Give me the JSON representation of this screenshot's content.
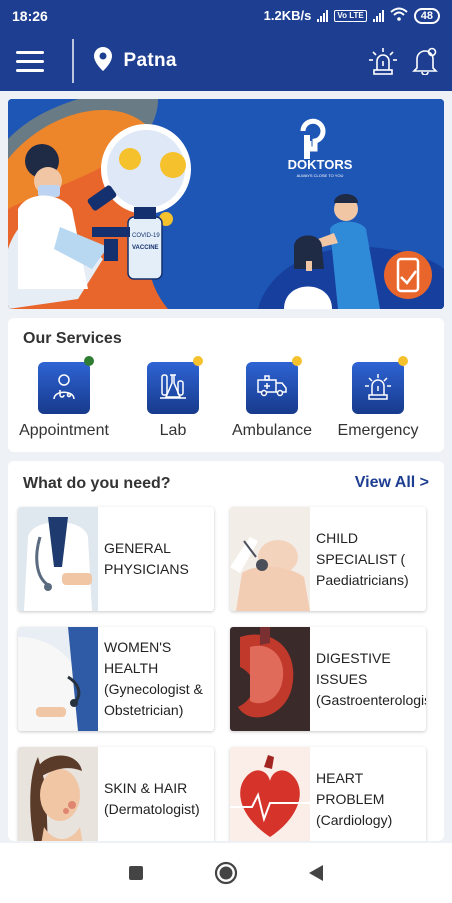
{
  "status_bar": {
    "time": "18:26",
    "speed": "1.2KB/s",
    "volte": "Vo LTE",
    "battery": "48"
  },
  "app_bar": {
    "city": "Patna",
    "menu_icon": "hamburger-menu-icon",
    "location_icon": "location-pin-icon",
    "alert_icon": "emergency-siren-icon",
    "notification_icon": "bell-icon"
  },
  "banner": {
    "brand_name": "DOKTORS",
    "tagline": "ALWAYS CLOSE TO YOU",
    "vial_top": "COVID-19",
    "vial_label": "VACCINE"
  },
  "services": {
    "title": "Our Services",
    "items": [
      {
        "label": "Appointment",
        "icon": "doctor-icon",
        "badge": "#2e7d32"
      },
      {
        "label": "Lab",
        "icon": "lab-flask-icon",
        "badge": "#f5c12c"
      },
      {
        "label": "Ambulance",
        "icon": "ambulance-icon",
        "badge": "#f5c12c"
      },
      {
        "label": "Emergency",
        "icon": "emergency-siren-icon",
        "badge": "#f5c12c"
      }
    ]
  },
  "needs": {
    "title": "What do you need?",
    "view_all": "View All >",
    "items": [
      {
        "label": "GENERAL PHYSICIANS",
        "image": "general-physician-photo"
      },
      {
        "label": "CHILD SPECIALIST ( Paediatricians)",
        "image": "child-specialist-photo"
      },
      {
        "label": "WOMEN'S HEALTH (Gynecologist & Obstetrician)",
        "image": "womens-health-photo"
      },
      {
        "label": "DIGESTIVE ISSUES (Gastroenterologist)",
        "image": "digestive-photo"
      },
      {
        "label": "SKIN & HAIR (Dermatologist)",
        "image": "skin-hair-photo"
      },
      {
        "label": "HEART PROBLEM (Cardiology)",
        "image": "heart-photo"
      }
    ]
  },
  "nav_bar": {
    "recents_icon": "square-recents-icon",
    "home_icon": "circle-home-icon",
    "back_icon": "triangle-back-icon"
  },
  "colors": {
    "primary": "#1e3f91",
    "accent_yellow": "#f5c12c",
    "background": "#eef1f6"
  }
}
